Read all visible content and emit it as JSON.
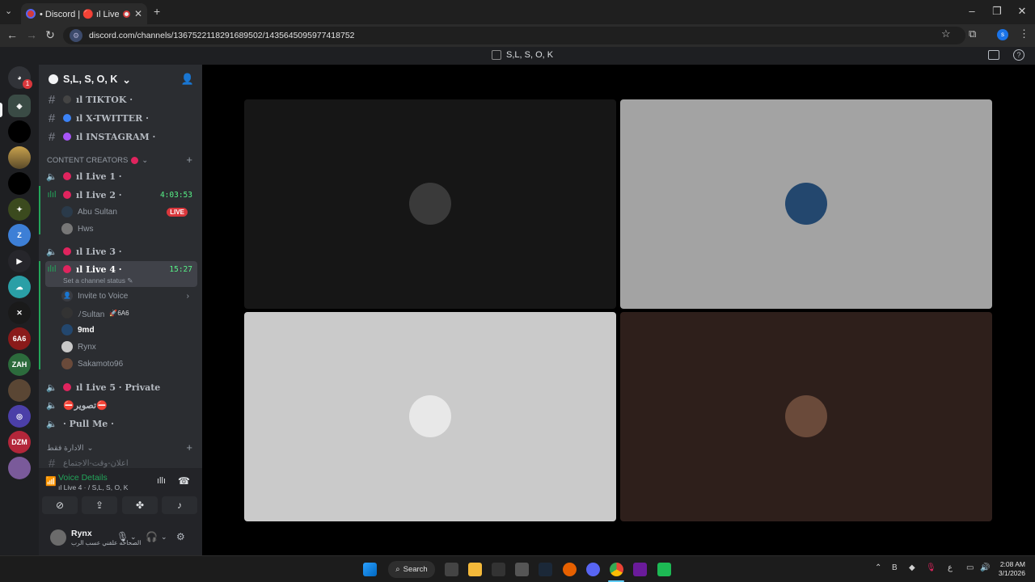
{
  "browser": {
    "tab_title": "• Discord | 🔴 ıl Live 4 · | S",
    "url": "discord.com/channels/1367522118291689502/1435645095977418752",
    "profile_initial": "s"
  },
  "discord": {
    "window_title": "S,L, S, O, K",
    "rail": {
      "badge_count": "1"
    },
    "server": {
      "name": "S,L, S, O, K"
    },
    "text_channels": [
      {
        "name": "ıl TIKTOK ·",
        "dot": "#555555"
      },
      {
        "name": "ıl X-TWITTER ·",
        "dot": "#3b82f6"
      },
      {
        "name": "ıl INSTAGRAM ·",
        "dot": "#a855f7"
      }
    ],
    "category_content": "CONTENT CREATORS",
    "voice_channels": {
      "live1": {
        "name": "ıl Live 1 ·"
      },
      "live2": {
        "name": "ıl Live 2 ·",
        "timer": "4:03:53"
      },
      "live2_users": [
        {
          "name": "Abu Sultan",
          "badge": "LIVE"
        },
        {
          "name": "Hws"
        }
      ],
      "live3": {
        "name": "ıl Live 3 ·"
      },
      "live4": {
        "name": "ıl Live 4 ·",
        "timer": "15:27",
        "status_placeholder": "Set a channel status"
      },
      "live4_invite": "Invite to Voice",
      "live4_users": [
        {
          "name": "ﾉSultan",
          "tag": "🚀6A6"
        },
        {
          "name": "9md"
        },
        {
          "name": "Rynx"
        },
        {
          "name": "Sakamoto96"
        }
      ],
      "live5": {
        "name": "ıl Live 5 · Private"
      },
      "photo": {
        "name": "⛔تصوير⛔"
      },
      "pullme": {
        "name": "· Pull Me ·"
      }
    },
    "category_admin": "الادارة فقط",
    "admin_channel": "اعلان-وقت-الاجتماع",
    "voice_panel": {
      "title": "Voice Details",
      "subtitle": "ıl Live 4 · / S,L, S, O, K"
    },
    "user_panel": {
      "name": "Rynx",
      "status": "الصحاحه علقني عسب الرب"
    },
    "tiles": [
      {
        "bg": "#161616",
        "avatar_bg": "#3a3a3a"
      },
      {
        "bg": "#a3a3a3",
        "avatar_bg": "#23476e"
      },
      {
        "bg": "#cacaca",
        "avatar_bg": "#e8e8e8"
      },
      {
        "bg": "#2e1f1b",
        "avatar_bg": "#6a4a3a"
      }
    ]
  },
  "taskbar": {
    "search_label": "Search",
    "time": "2:08 AM",
    "date": "3/1/2026",
    "lang": "ع"
  }
}
